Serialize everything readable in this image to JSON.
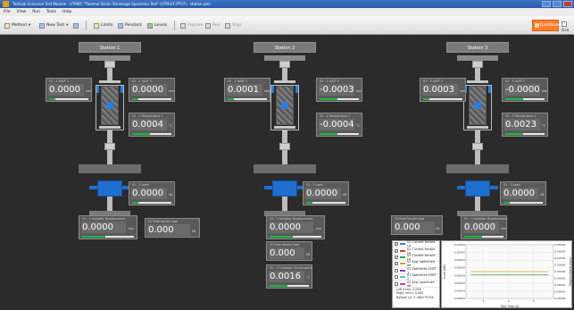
{
  "window": {
    "title": "TestLab Universal Test Module - UTM05 \"Thermal Strain Shrinkage Specimen Test\" (UTM-EF-PT07) - station.utm"
  },
  "menu": [
    "File",
    "View",
    "Run",
    "Tools",
    "Help"
  ],
  "toolbar": {
    "items": [
      "Method",
      "New Test",
      "Limits",
      "Pendant",
      "Levels",
      "Prepare",
      "Run",
      "Stop",
      "Dashboard",
      "Gra"
    ]
  },
  "stations": [
    {
      "label": "Station 1",
      "readouts": [
        {
          "cap": "S1 - 1 LVDT 1",
          "val": "0.0000",
          "unit": "mm",
          "fill": 0.15
        },
        {
          "cap": "S1 - 1 LVDT 2",
          "val": "0.0000",
          "unit": "mm",
          "fill": 0.15
        },
        {
          "cap": "S1 - 1 Temperature 1",
          "val": "0.0004",
          "unit": "°C",
          "fill": 0.45
        },
        {
          "cap": "S1 - 1 Load",
          "val": "0.0000",
          "unit": "kN",
          "fill": 0.15
        },
        {
          "cap": "S1 - 1 Actuator Displacement",
          "val": "0.0000",
          "unit": "mm",
          "fill": 0.45
        },
        {
          "cap": "S1 Peak tensile load",
          "val": "0.000",
          "unit": "kN",
          "fill": null
        }
      ]
    },
    {
      "label": "Station 2",
      "readouts": [
        {
          "cap": "S2 - 2 LVDT 1",
          "val": "0.0001",
          "unit": "mm",
          "fill": 0.15
        },
        {
          "cap": "S2 - 2 LVDT 2",
          "val": "-0.0003",
          "unit": "mm",
          "fill": 0.45
        },
        {
          "cap": "S2 - 2 Temperature 1",
          "val": "-0.0004",
          "unit": "°C",
          "fill": 0.45
        },
        {
          "cap": "S2 - 2 Load",
          "val": "0.0000",
          "unit": "kN",
          "fill": 0.15
        },
        {
          "cap": "S2 - 2 Actuator Displacement",
          "val": "0.0000",
          "unit": "mm",
          "fill": 0.45
        },
        {
          "cap": "S2 Peak tensile load",
          "val": "0.000",
          "unit": "kN",
          "fill": null
        },
        {
          "cap": "S2 - 2 Chamber Temperature",
          "val": "0.0016",
          "unit": "°C",
          "fill": 0.45
        }
      ]
    },
    {
      "label": "Station 3",
      "readouts": [
        {
          "cap": "S3 - 3 LVDT 1",
          "val": "0.0003",
          "unit": "mm",
          "fill": 0.15
        },
        {
          "cap": "S3 - 3 LVDT 2",
          "val": "-0.0000",
          "unit": "mm",
          "fill": 0.45
        },
        {
          "cap": "S3 - 3 Temperature 1",
          "val": "0.0023",
          "unit": "°C",
          "fill": 0.45
        },
        {
          "cap": "S3 - 3 Load",
          "val": "0.0000",
          "unit": "kN",
          "fill": 0.15
        },
        {
          "cap": "S3 - 3 Actuator Displacement",
          "val": "0.0000",
          "unit": "mm",
          "fill": 0.45
        },
        {
          "cap": "S3 Peak tensile load",
          "val": "0.000",
          "unit": "kN",
          "fill": null
        }
      ]
    }
  ],
  "legend": {
    "items": [
      {
        "label": "S1 Current tensile Lo",
        "checked": true,
        "color": "#3a7bd5"
      },
      {
        "label": "S2 Current tensile Lo",
        "checked": true,
        "color": "#d43a3a"
      },
      {
        "label": "S3 Current tensile Lo",
        "checked": true,
        "color": "#2da84a"
      },
      {
        "label": "S1 Avg. specimen de",
        "checked": true,
        "color": "#d4a02a"
      },
      {
        "label": "S1 Specimen LVDT 1",
        "checked": false,
        "color": "#8a3ad4"
      },
      {
        "label": "S1 Specimen LVDT 2",
        "checked": false,
        "color": "#3ad4c8"
      },
      {
        "label": "S2 Avg. specimen de",
        "checked": false,
        "color": "#d43aa8"
      }
    ],
    "footer": [
      "Left (mm): 0.000",
      "Right (mm): 0.000",
      "Bottom (s): 1.460278746"
    ]
  },
  "chart_data": {
    "type": "line",
    "xlabel": "Test Time (s)",
    "ylabel_left": "Load (kN)",
    "ylabel_right": "Displacement (mm)",
    "x_ticks": [
      "1",
      "2",
      "3"
    ],
    "y_ticks_left": [
      "0.00000",
      "0.00000",
      "0.00000",
      "0.00000",
      "0.00000",
      "0.00000",
      "0.00000",
      "0.00000"
    ],
    "y_ticks_right": [
      "0.00000",
      "0.00000",
      "0.00000",
      "0.00000",
      "0.00000",
      "0.00000",
      "0.00000",
      "0.00000",
      "0.00000"
    ],
    "series": [
      {
        "values_x": [
          0.5,
          3.6
        ],
        "values_y": [
          4e-05,
          4e-05
        ]
      },
      {
        "values_x": [
          0.5,
          3.6
        ],
        "values_y": [
          3.5e-05,
          3.5e-05
        ]
      }
    ],
    "colors": [
      "#d4a02a",
      "#2da84a"
    ]
  }
}
